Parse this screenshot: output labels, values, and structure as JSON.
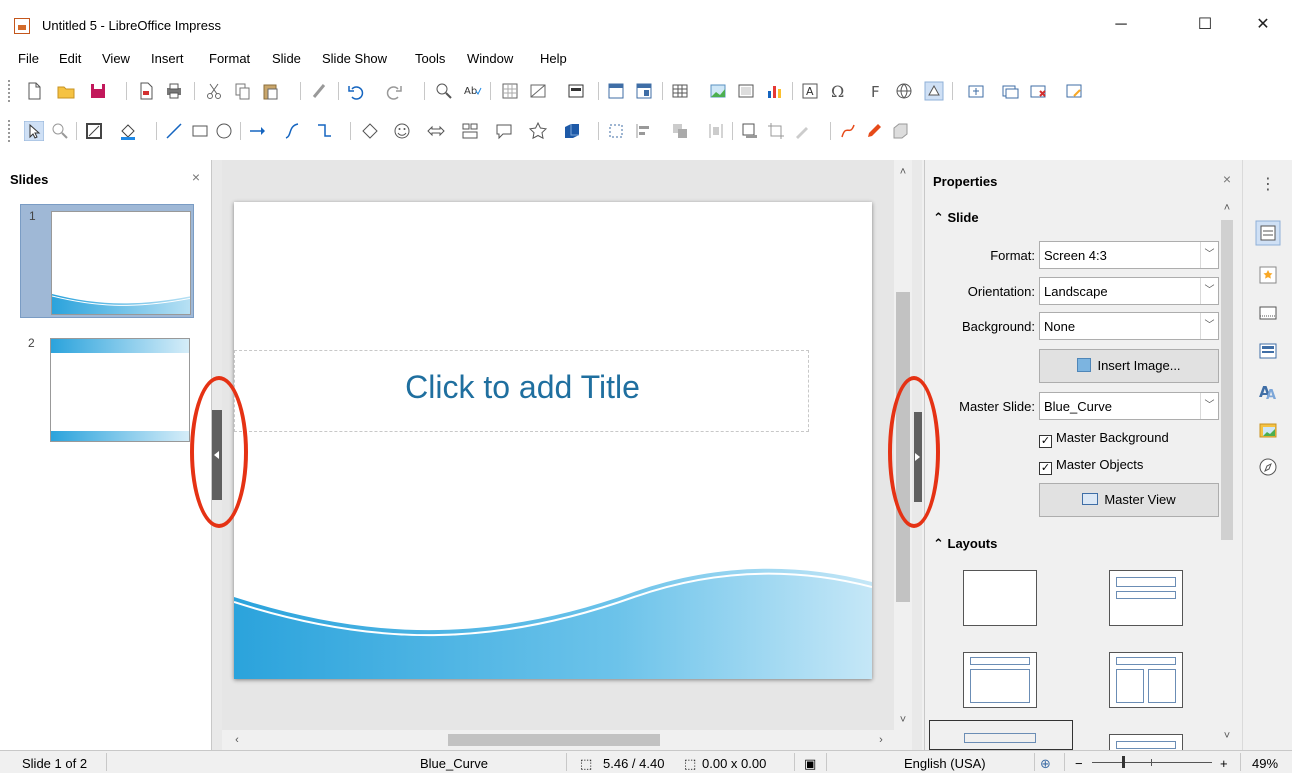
{
  "window": {
    "title": "Untitled 5 - LibreOffice Impress",
    "minimize_label": "─",
    "maximize_label": "☐",
    "close_label": "✕"
  },
  "menubar": {
    "items": [
      "File",
      "Edit",
      "View",
      "Insert",
      "Format",
      "Slide",
      "Slide Show",
      "Tools",
      "Window",
      "Help"
    ]
  },
  "slides_panel": {
    "title": "Slides",
    "close_label": "×",
    "slides": [
      {
        "number": "1",
        "selected": true
      },
      {
        "number": "2",
        "selected": false
      }
    ]
  },
  "slide": {
    "title_placeholder": "Click to add Title"
  },
  "properties": {
    "title": "Properties",
    "close_label": "×",
    "slide_section": "Slide",
    "format_label": "Format:",
    "format_value": "Screen 4:3",
    "orientation_label": "Orientation:",
    "orientation_value": "Landscape",
    "background_label": "Background:",
    "background_value": "None",
    "insert_image_label": "Insert Image...",
    "master_slide_label": "Master Slide:",
    "master_slide_value": "Blue_Curve",
    "master_background_label": "Master Background",
    "master_background_checked": true,
    "master_objects_label": "Master Objects",
    "master_objects_checked": true,
    "master_view_label": "Master View",
    "layouts_section": "Layouts"
  },
  "statusbar": {
    "slide_info": "Slide 1 of 2",
    "master": "Blue_Curve",
    "position": "5.46 / 4.40",
    "size": "0.00 x 0.00",
    "language": "English (USA)",
    "zoom": "49%"
  },
  "colors": {
    "accent_blue": "#1f6f9f",
    "annotation_red": "#e53214",
    "wave_blue": "#2ba3dc"
  }
}
